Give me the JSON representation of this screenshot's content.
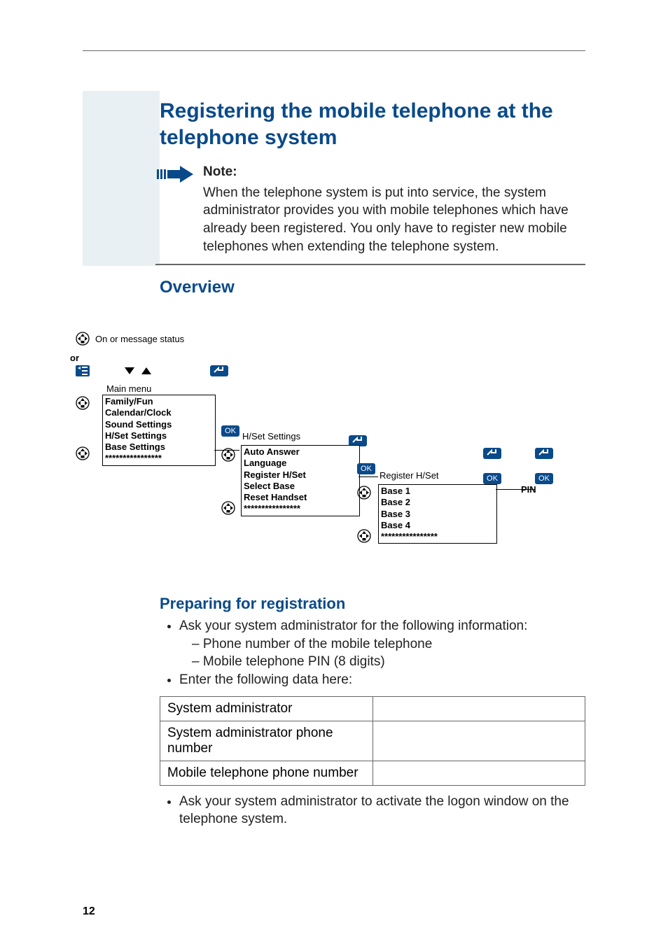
{
  "page_number": "12",
  "title": "Registering the mobile telephone at the telephone system",
  "note": {
    "label": "Note:",
    "text": "When the telephone system is put into service, the system administrator provides you with mobile telephones which have already been registered. You only have to register new mobile telephones when extending the telephone system."
  },
  "overview_heading": "Overview",
  "diagram": {
    "status_text": "On or message status",
    "or_label": "or",
    "main_menu_label": "Main menu",
    "menu1": {
      "items": [
        "Family/Fun",
        "Calendar/Clock",
        "Sound Settings",
        "H/Set Settings",
        "Base Settings",
        "****************"
      ]
    },
    "ok_label": "OK",
    "hset_label": "H/Set Settings",
    "menu2": {
      "items": [
        "Auto Answer",
        "Language",
        "Register H/Set",
        "Select Base",
        "Reset Handset",
        "****************"
      ]
    },
    "register_label": "Register H/Set",
    "menu3": {
      "items": [
        "Base 1",
        "Base 2",
        "Base 3",
        "Base 4",
        "****************"
      ]
    },
    "pin_label": "PIN"
  },
  "prep": {
    "heading": "Preparing for registration",
    "bullet1": "Ask your system administrator for the following information:",
    "sub1": "Phone number of the mobile telephone",
    "sub2": "Mobile telephone PIN (8 digits)",
    "bullet2": "Enter the following data here:",
    "table": {
      "r1": "System administrator",
      "r2": "System administrator phone number",
      "r3": "Mobile telephone phone number"
    },
    "bullet3": "Ask your system administrator to activate the logon window on the telephone system."
  }
}
